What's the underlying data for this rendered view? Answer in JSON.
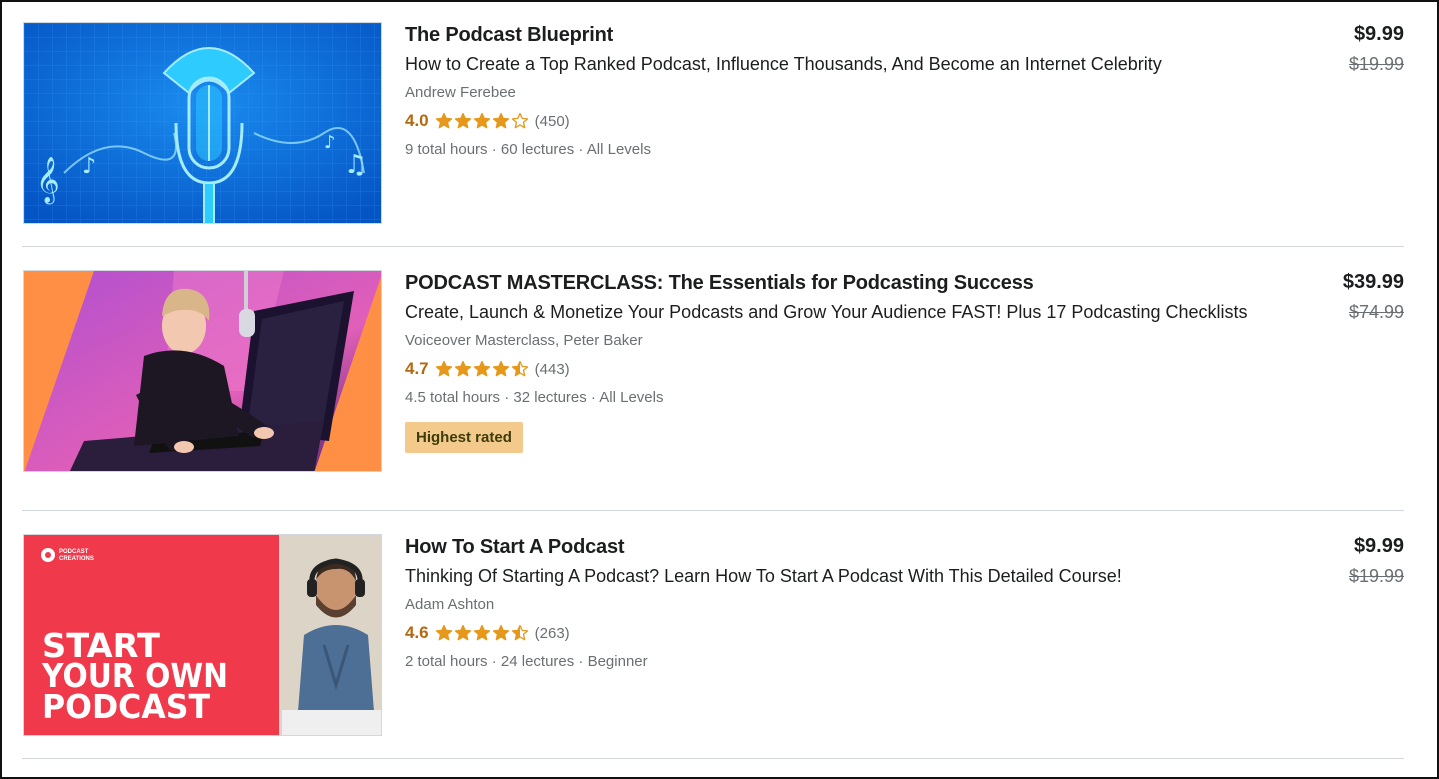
{
  "courses": [
    {
      "title": "The Podcast Blueprint",
      "headline": "How to Create a Top Ranked Podcast, Influence Thousands, And Become an Internet Celebrity",
      "instructor": "Andrew Ferebee",
      "rating": "4.0",
      "rating_value": 4.0,
      "reviews": "(450)",
      "meta": "9 total hours · 60 lectures · All Levels",
      "price": "$9.99",
      "original_price": "$19.99",
      "badge": "",
      "thumbnail": {
        "kind": "microphone-blueprint",
        "bg": "#0a69d8"
      }
    },
    {
      "title": "PODCAST MASTERCLASS: The Essentials for Podcasting Success",
      "headline": "Create, Launch & Monetize Your Podcasts and Grow Your Audience FAST! Plus 17 Podcasting Checklists",
      "instructor": "Voiceover Masterclass, Peter Baker",
      "rating": "4.7",
      "rating_value": 4.7,
      "reviews": "(443)",
      "meta": "4.5 total hours · 32 lectures · All Levels",
      "price": "$39.99",
      "original_price": "$74.99",
      "badge": "Highest rated",
      "thumbnail": {
        "kind": "woman-at-desk",
        "bg": "#ff8f45"
      }
    },
    {
      "title": "How To Start A Podcast",
      "headline": "Thinking Of Starting A Podcast? Learn How To Start A Podcast With This Detailed Course!",
      "instructor": "Adam Ashton",
      "rating": "4.6",
      "rating_value": 4.6,
      "reviews": "(263)",
      "meta": "2 total hours · 24 lectures · Beginner",
      "price": "$9.99",
      "original_price": "$19.99",
      "badge": "",
      "thumbnail": {
        "kind": "start-your-own-podcast",
        "bg": "#f0394b",
        "brand_line1": "PODCAST",
        "brand_line2": "CREATIONS",
        "headline_lines": [
          "START",
          "YOUR OWN",
          "PODCAST"
        ]
      }
    }
  ],
  "colors": {
    "star": "#e59819",
    "rating_text": "#b4690e",
    "badge_bg": "#f3ca8c",
    "muted_text": "#6a6f73"
  }
}
